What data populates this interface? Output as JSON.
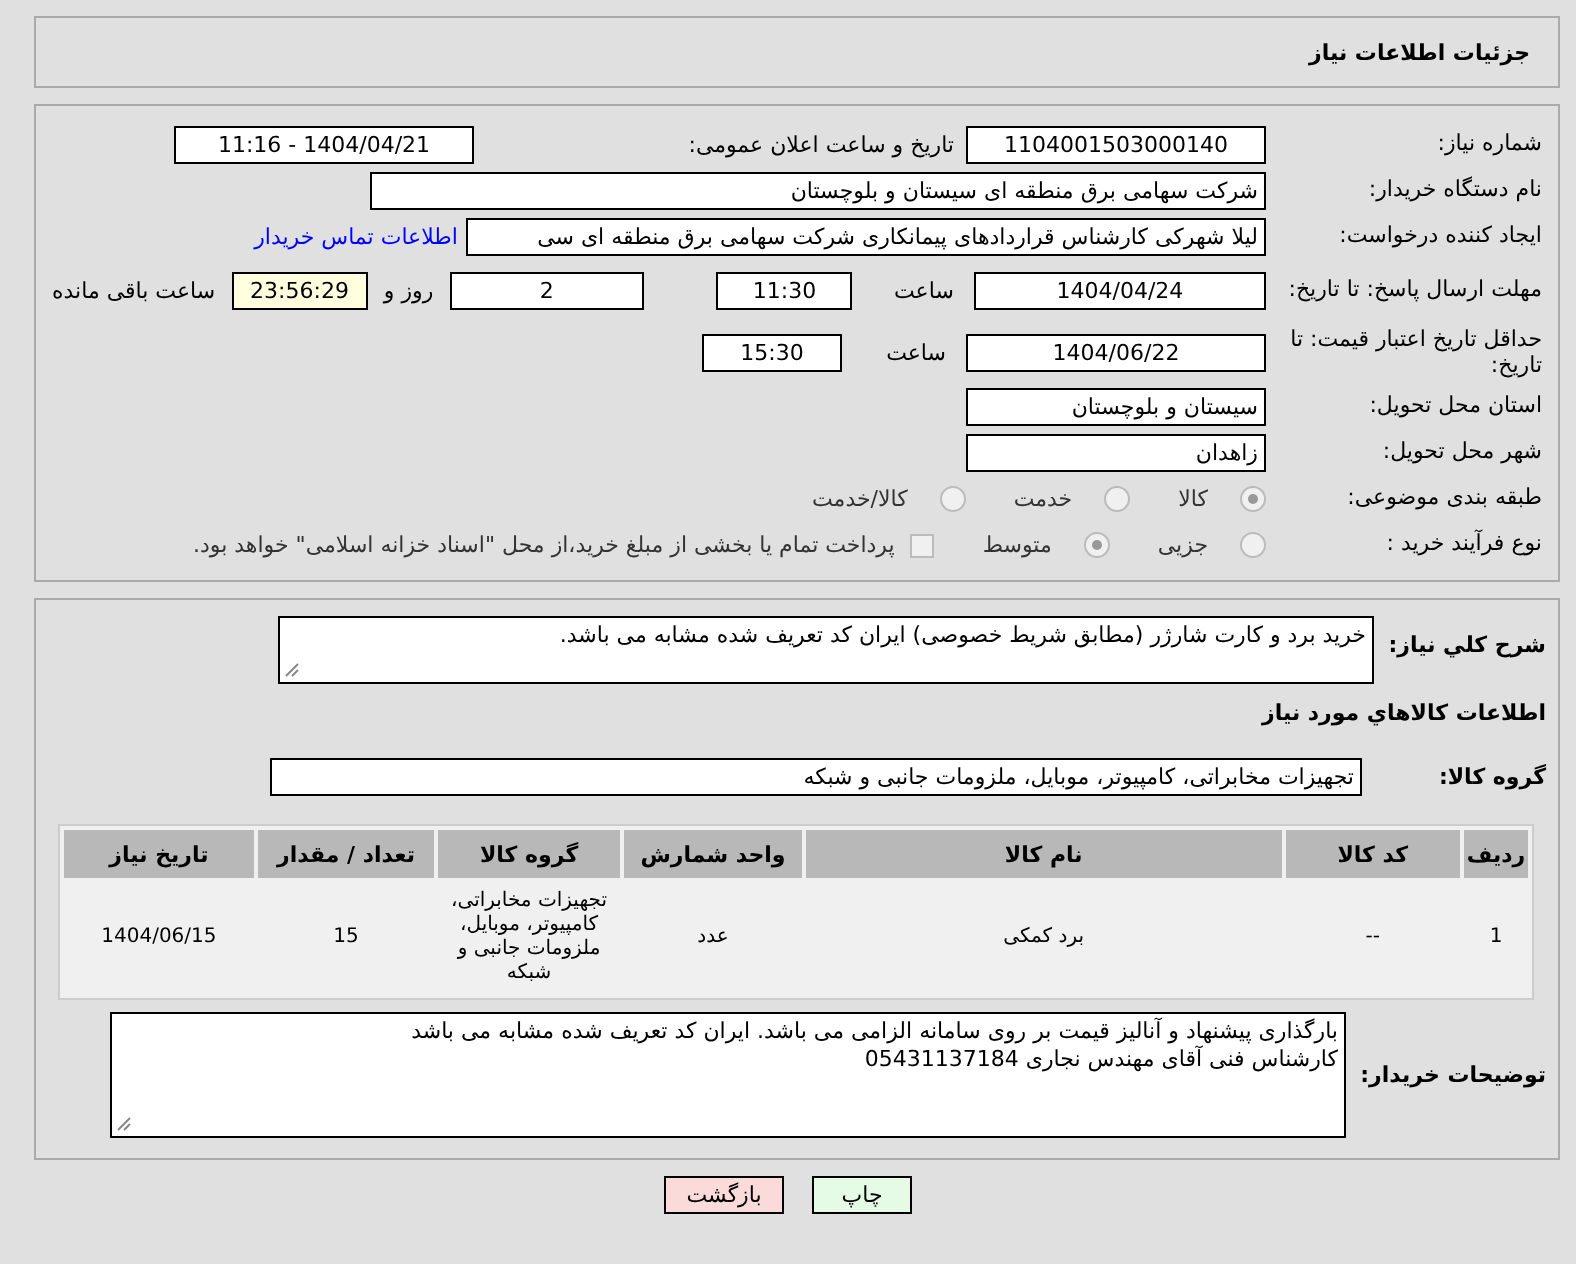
{
  "header": {
    "title": "جزئیات اطلاعات نیاز"
  },
  "need_number": {
    "label": "شماره نیاز:",
    "value": "1104001503000140"
  },
  "announce": {
    "label": "تاریخ و ساعت اعلان عمومی:",
    "value": "1404/04/21 - 11:16"
  },
  "buyer_org": {
    "label": "نام دستگاه خریدار:",
    "value": "شرکت سهامی برق منطقه ای سیستان و بلوچستان"
  },
  "requester": {
    "label": "ایجاد کننده درخواست:",
    "value": "لیلا شهرکی کارشناس قراردادهای پیمانکاری شرکت سهامی برق منطقه ای سی",
    "link": "اطلاعات تماس خریدار"
  },
  "reply_deadline": {
    "label": "مهلت ارسال پاسخ: تا تاریخ:",
    "date": "1404/04/24",
    "time_label": "ساعت",
    "time": "11:30",
    "days": "2",
    "days_label": "روز و",
    "remaining": "23:56:29",
    "remaining_label": "ساعت باقی مانده"
  },
  "price_validity": {
    "label": "حداقل تاریخ اعتبار قیمت: تا تاریخ:",
    "date": "1404/06/22",
    "time_label": "ساعت",
    "time": "15:30"
  },
  "province": {
    "label": "استان محل تحویل:",
    "value": "سیستان و بلوچستان"
  },
  "city": {
    "label": "شهر محل تحویل:",
    "value": "زاهدان"
  },
  "category": {
    "label": "طبقه بندی موضوعی:",
    "options": [
      {
        "label": "کالا",
        "selected": true
      },
      {
        "label": "خدمت",
        "selected": false
      },
      {
        "label": "کالا/خدمت",
        "selected": false
      }
    ]
  },
  "process": {
    "label": "نوع فرآیند خرید :",
    "options": [
      {
        "label": "جزیی",
        "selected": false
      },
      {
        "label": "متوسط",
        "selected": true
      }
    ],
    "payment": {
      "checked": false,
      "text": "پرداخت تمام یا بخشی از مبلغ خرید،از محل \"اسناد خزانه اسلامی\" خواهد بود."
    }
  },
  "description": {
    "label": "شرح کلي نياز:",
    "value": "خرید برد و کارت شارژر (مطابق شریط خصوصی) ایران کد تعریف شده مشابه می باشد."
  },
  "goods_title": "اطلاعات کالاهاي مورد نياز",
  "goods_group": {
    "label": "گروه کالا:",
    "value": "تجهیزات مخابراتی، کامپیوتر، موبایل، ملزومات جانبی و شبکه"
  },
  "table": {
    "columns": [
      "ردیف",
      "کد کالا",
      "نام کالا",
      "واحد شمارش",
      "گروه کالا",
      "تعداد / مقدار",
      "تاریخ نیاز"
    ],
    "rows": [
      [
        "1",
        "--",
        "برد کمکی",
        "عدد",
        "تجهیزات مخابراتی، کامپیوتر، موبایل، ملزومات جانبی و شبکه",
        "15",
        "1404/06/15"
      ]
    ]
  },
  "buyer_notes": {
    "label": "توضیحات خریدار:",
    "lines": [
      "بارگذاری پیشنهاد و آنالیز قیمت بر روی سامانه الزامی می باشد. ایران کد تعریف شده مشابه می باشد",
      "کارشناس فنی آقای مهندس نجاری 05431137184"
    ]
  },
  "buttons": [
    {
      "label": "چاپ",
      "kind": "print"
    },
    {
      "label": "بازگشت",
      "kind": "back"
    }
  ]
}
